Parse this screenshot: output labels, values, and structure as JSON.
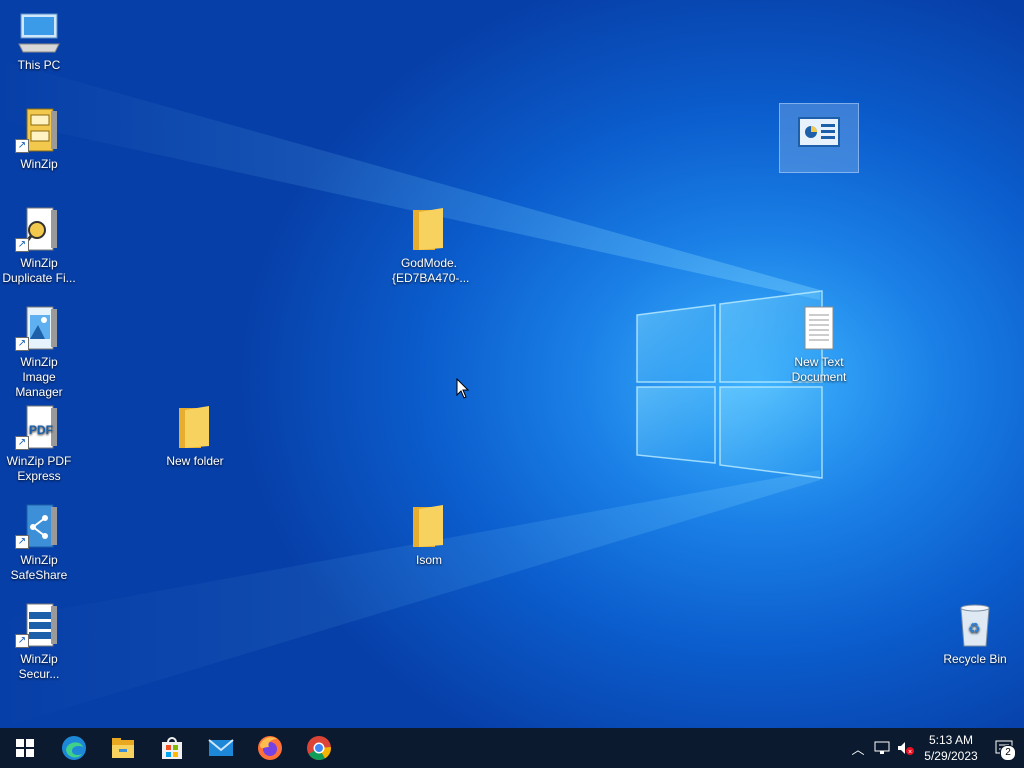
{
  "desktop": {
    "icons": {
      "this_pc": "This PC",
      "winzip": "WinZip",
      "winzip_duplicate": "WinZip Duplicate Fi...",
      "winzip_image": "WinZip Image Manager",
      "winzip_pdf": "WinZip PDF Express",
      "winzip_safeshare": "WinZip SafeShare",
      "winzip_secure": "WinZip Secur...",
      "new_folder": "New folder",
      "godmode": "GodMode.{ED7BA470-...",
      "isom": "Isom",
      "control_panel": "",
      "new_text_document": "New Text Document",
      "recycle_bin": "Recycle Bin"
    }
  },
  "taskbar": {
    "pinned": [
      "start-icon",
      "edge-icon",
      "file-explorer-icon",
      "microsoft-store-icon",
      "mail-icon",
      "firefox-icon",
      "chrome-icon"
    ],
    "clock_time": "5:13 AM",
    "clock_date": "5/29/2023",
    "notification_count": "2"
  },
  "colors": {
    "taskbar": "#0b1a2e",
    "desktop_bg": "#0b5ccc",
    "folder": "#f5c542"
  }
}
